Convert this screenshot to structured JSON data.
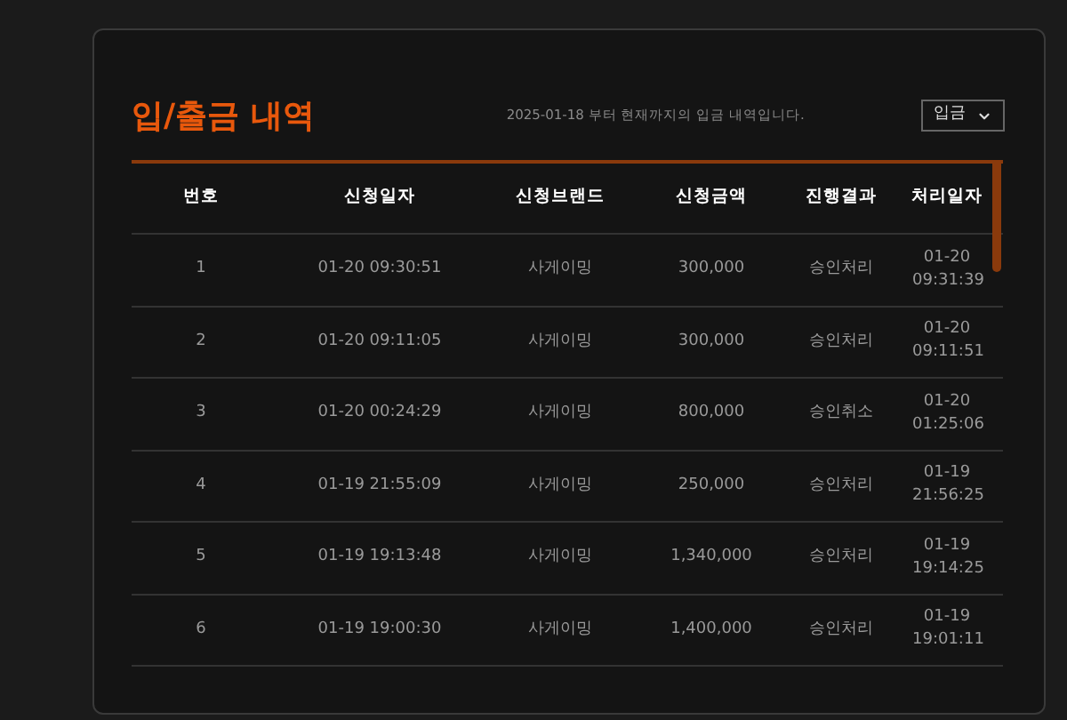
{
  "title": "입/출금 내역",
  "subtitle": "2025-01-18 부터 현재까지의 입금 내역입니다.",
  "filter": {
    "value": "입금"
  },
  "table": {
    "columns": [
      "번호",
      "신청일자",
      "신청브랜드",
      "신청금액",
      "진행결과",
      "처리일자"
    ],
    "rows": [
      [
        "1",
        "01-20 09:30:51",
        "사게이밍",
        "300,000",
        "승인처리",
        "01-20 09:31:39"
      ],
      [
        "2",
        "01-20 09:11:05",
        "사게이밍",
        "300,000",
        "승인처리",
        "01-20 09:11:51"
      ],
      [
        "3",
        "01-20 00:24:29",
        "사게이밍",
        "800,000",
        "승인취소",
        "01-20 01:25:06"
      ],
      [
        "4",
        "01-19 21:55:09",
        "사게이밍",
        "250,000",
        "승인처리",
        "01-19 21:56:25"
      ],
      [
        "5",
        "01-19 19:13:48",
        "사게이밍",
        "1,340,000",
        "승인처리",
        "01-19 19:14:25"
      ],
      [
        "6",
        "01-19 19:00:30",
        "사게이밍",
        "1,400,000",
        "승인처리",
        "01-19 19:01:11"
      ]
    ]
  }
}
